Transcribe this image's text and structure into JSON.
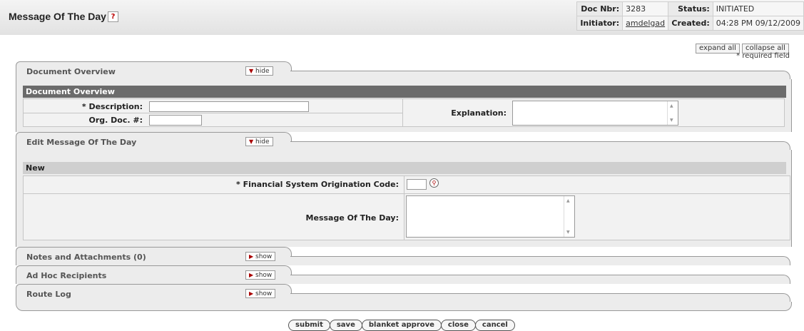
{
  "header": {
    "title": "Message Of The Day",
    "help": "?",
    "doc_nbr_label": "Doc Nbr:",
    "doc_nbr": "3283",
    "status_label": "Status:",
    "status": "INITIATED",
    "initiator_label": "Initiator:",
    "initiator": "amdelgad",
    "created_label": "Created:",
    "created": "04:28 PM 09/12/2009"
  },
  "controls": {
    "expand_all": "expand all",
    "collapse_all": "collapse all",
    "required_note": "* required field"
  },
  "tabs": {
    "overview": {
      "label": "Document Overview",
      "toggle": "hide"
    },
    "edit": {
      "label": "Edit Message Of The Day",
      "toggle": "hide"
    },
    "notes": {
      "label": "Notes and Attachments (0)",
      "toggle": "show"
    },
    "adhoc": {
      "label": "Ad Hoc Recipients",
      "toggle": "show"
    },
    "routelog": {
      "label": "Route Log",
      "toggle": "show"
    }
  },
  "overview": {
    "section_title": "Document Overview",
    "description_label": "* Description:",
    "description_value": "",
    "org_doc_label": "Org. Doc. #:",
    "org_doc_value": "",
    "explanation_label": "Explanation:",
    "explanation_value": ""
  },
  "edit": {
    "section_title": "New",
    "origination_label": "* Financial System Origination Code:",
    "origination_value": "",
    "message_label": "Message Of The Day:",
    "message_value": ""
  },
  "buttons": [
    "submit",
    "save",
    "blanket approve",
    "close",
    "cancel"
  ],
  "colors": {
    "section_dark": "#6b6b6b",
    "section_light": "#cfcfcf",
    "accent_red": "#a00000"
  }
}
